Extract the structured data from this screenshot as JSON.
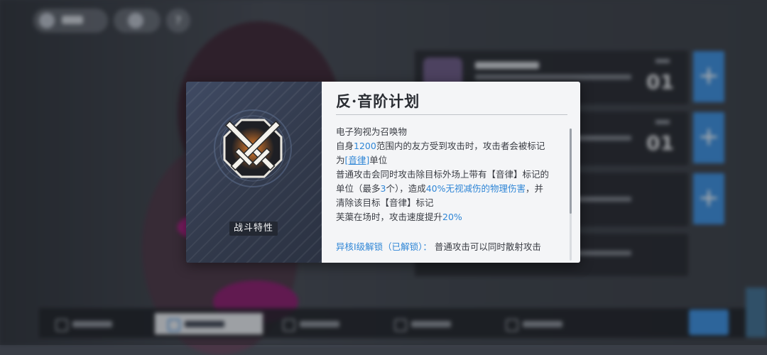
{
  "dialog": {
    "badge": "战斗特性",
    "title": "反·音阶计划",
    "desc": {
      "l1": "电子狗视为召唤物",
      "l2a": "自身",
      "l2b": "1200",
      "l2c": "范围内的友方受到攻击时，攻击者会被标记",
      "l3a": "为",
      "l3b": "[音律]",
      "l3c": "单位",
      "l4": "普通攻击会同时攻击除目标外场上带有【音律】标记的",
      "l5a": "单位（最多",
      "l5b": "3",
      "l5c": "个），造成",
      "l5d": "40%无视减伤的物理伤害",
      "l5e": "，并",
      "l6": "清除该目标【音律】标记",
      "l7a": "芙蕖在场时，攻击速度提升",
      "l7b": "20%"
    },
    "unlock_label": "异核I级解锁（已解锁）：",
    "unlock_text": "普通攻击可以同时散射攻击"
  },
  "background": {
    "slot_levels": [
      "01",
      "01"
    ]
  },
  "colors": {
    "accent_blue": "#2f86d6",
    "plus_button": "#3b8fe0",
    "badge_bg": "#232832"
  },
  "icons": [
    "crossed-swords-icon",
    "plus-icon",
    "settings-icon",
    "help-icon"
  ]
}
